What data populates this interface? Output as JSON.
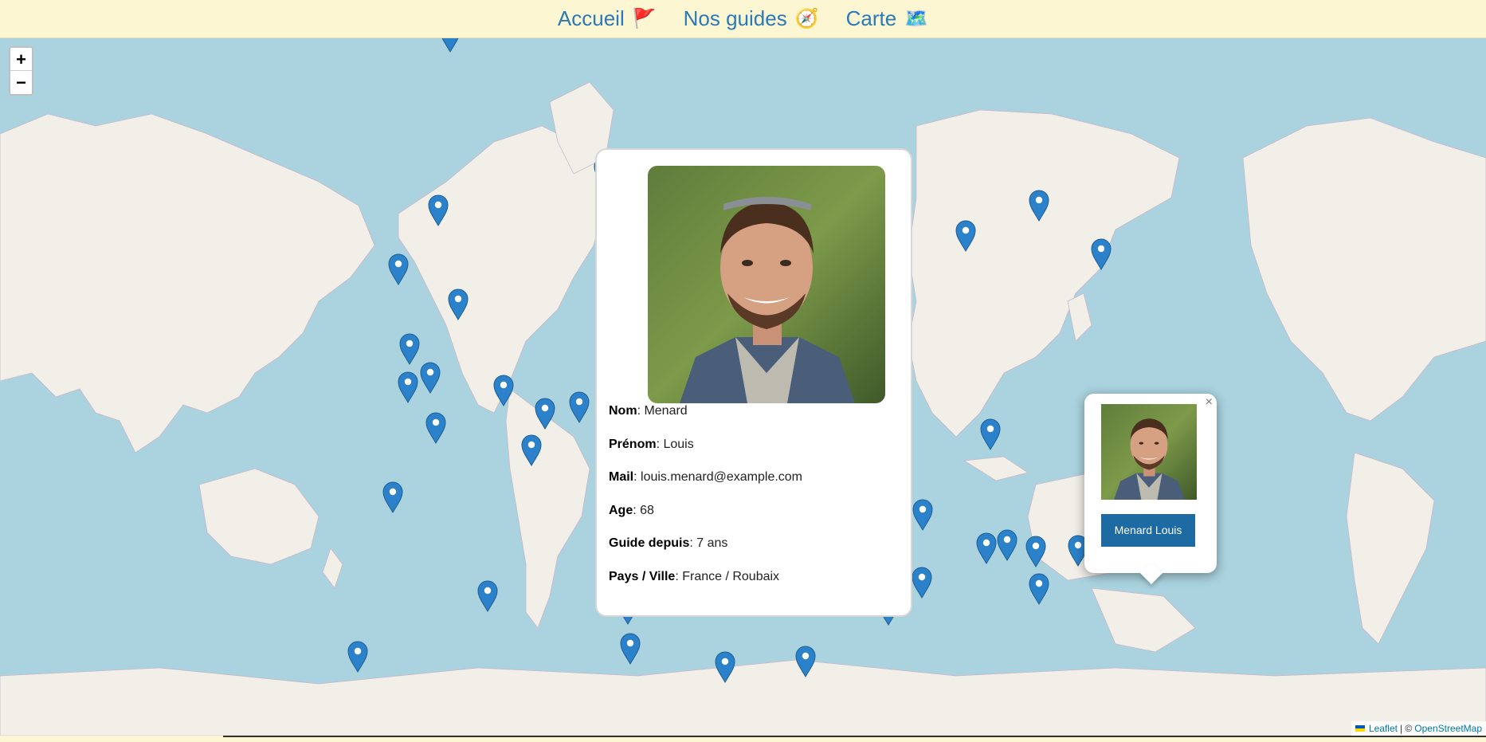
{
  "nav": {
    "items": [
      {
        "label": "Accueil",
        "icon": "🚩"
      },
      {
        "label": "Nos guides",
        "icon": "🧭"
      },
      {
        "label": "Carte",
        "icon": "🗺️"
      }
    ]
  },
  "zoom": {
    "in": "+",
    "out": "−"
  },
  "guide": {
    "fields": [
      {
        "label": "Nom",
        "value": "Menard"
      },
      {
        "label": "Prénom",
        "value": "Louis"
      },
      {
        "label": "Mail",
        "value": "louis.menard@example.com"
      },
      {
        "label": "Age",
        "value": "68"
      },
      {
        "label": "Guide depuis",
        "value": "7 ans"
      },
      {
        "label": "Pays / Ville",
        "value": "France / Roubaix"
      }
    ]
  },
  "popup": {
    "close": "×",
    "button_label": "Menard Louis"
  },
  "attribution": {
    "leaflet": "Leaflet",
    "separator": "| ©",
    "osm": "OpenStreetMap"
  },
  "colors": {
    "marker": "#2b82cb",
    "nav_text": "#2a7ab8",
    "button": "#1e6aa2",
    "water": "#aad3df",
    "land": "#f2efe9"
  }
}
